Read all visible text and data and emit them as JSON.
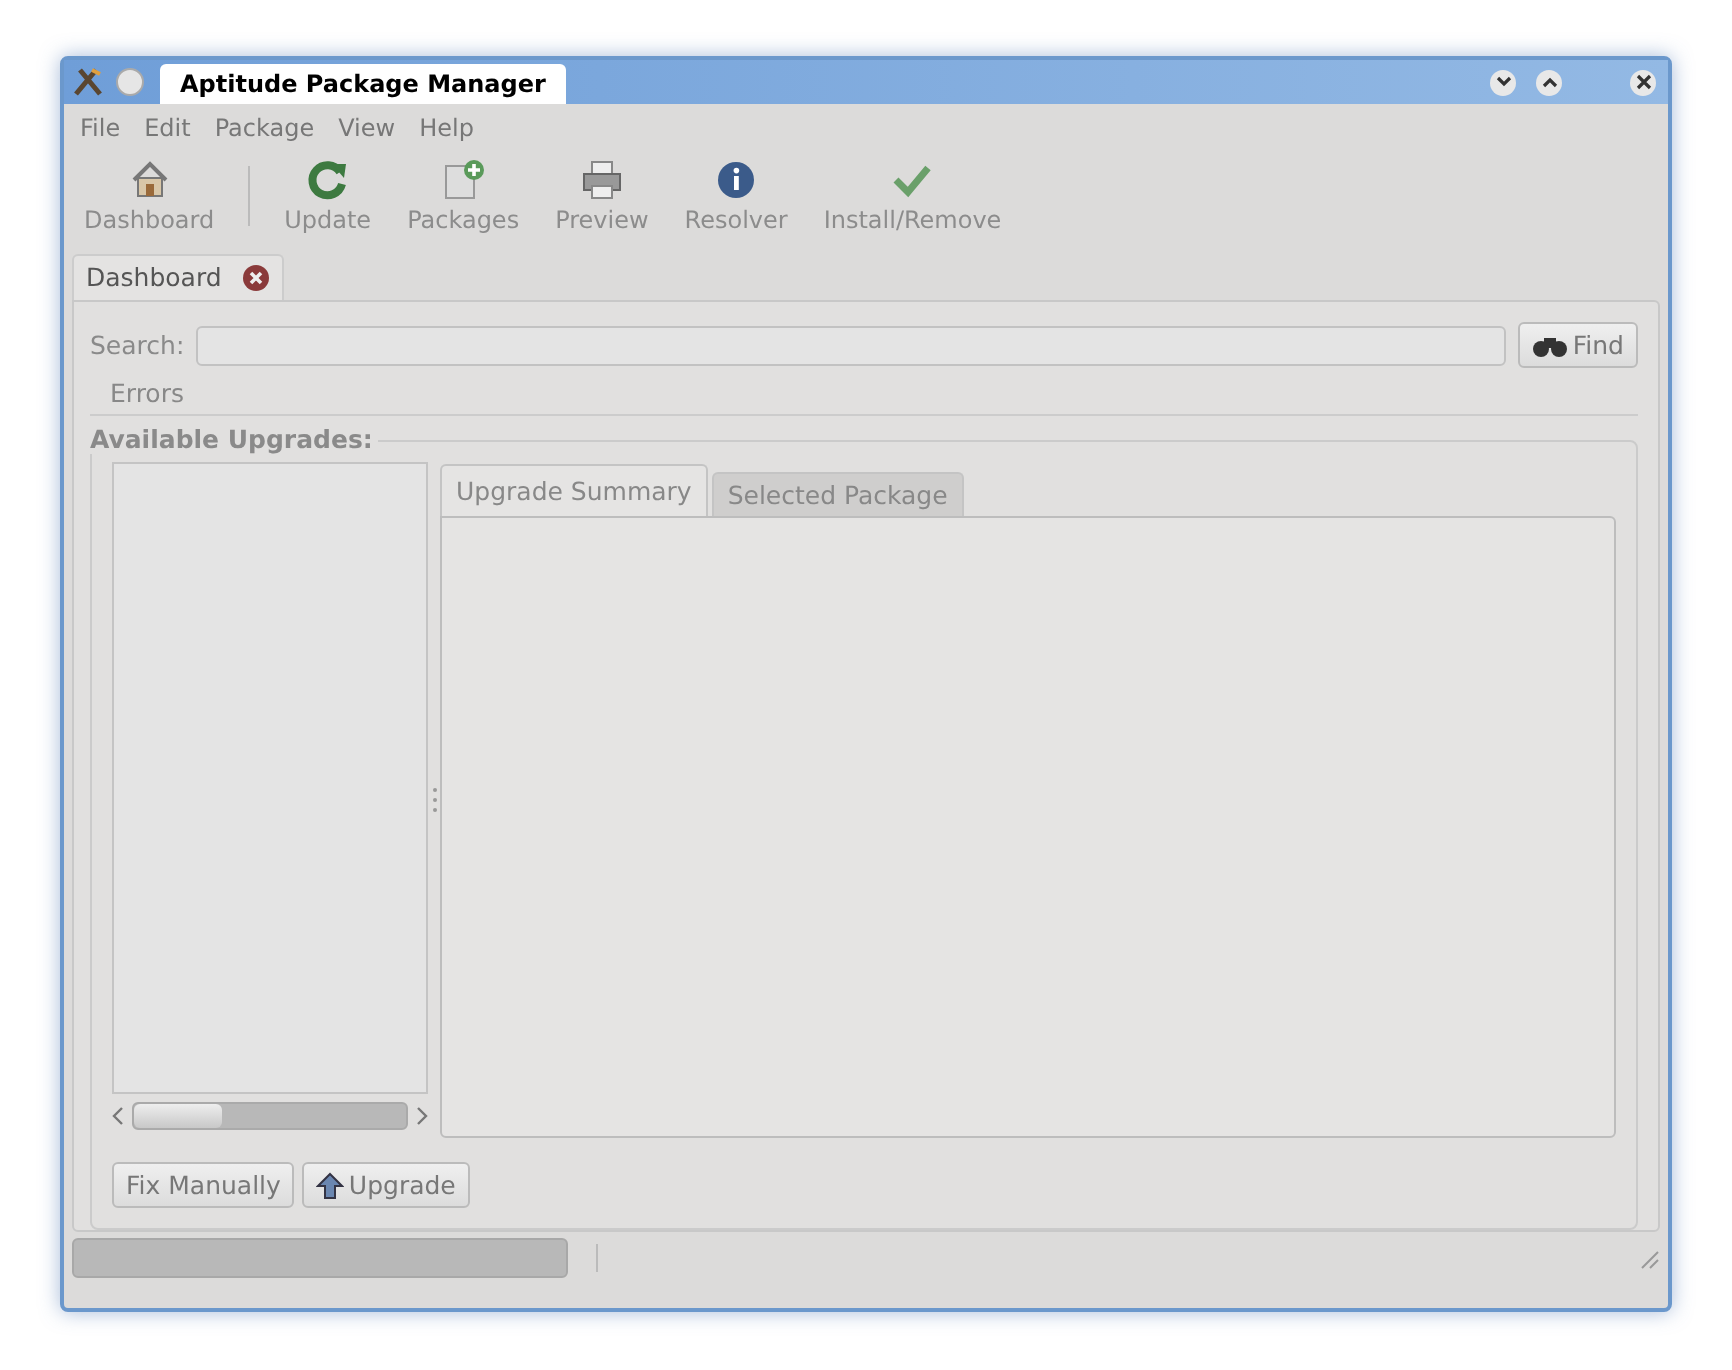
{
  "window": {
    "title": "Aptitude Package Manager"
  },
  "menu": [
    "File",
    "Edit",
    "Package",
    "View",
    "Help"
  ],
  "toolbar": [
    {
      "label": "Dashboard",
      "disabled": true
    },
    {
      "label": "Update",
      "disabled": true
    },
    {
      "label": "Packages",
      "disabled": true
    },
    {
      "label": "Preview",
      "disabled": true
    },
    {
      "label": "Resolver",
      "disabled": true
    },
    {
      "label": "Install/Remove",
      "disabled": true
    }
  ],
  "tabs": [
    {
      "label": "Dashboard",
      "selected": true
    }
  ],
  "search": {
    "label": "Search:",
    "button": "Find"
  },
  "errors": "Errors",
  "upgrades": {
    "title": "Available Upgrades:",
    "tabs": [
      {
        "label": "Upgrade Summary",
        "selected": true
      },
      {
        "label": "Selected Package",
        "selected": false
      }
    ],
    "buttons": [
      {
        "label": "Fix Manually"
      },
      {
        "label": "Upgrade"
      }
    ]
  },
  "status": {
    "level": 0
  }
}
